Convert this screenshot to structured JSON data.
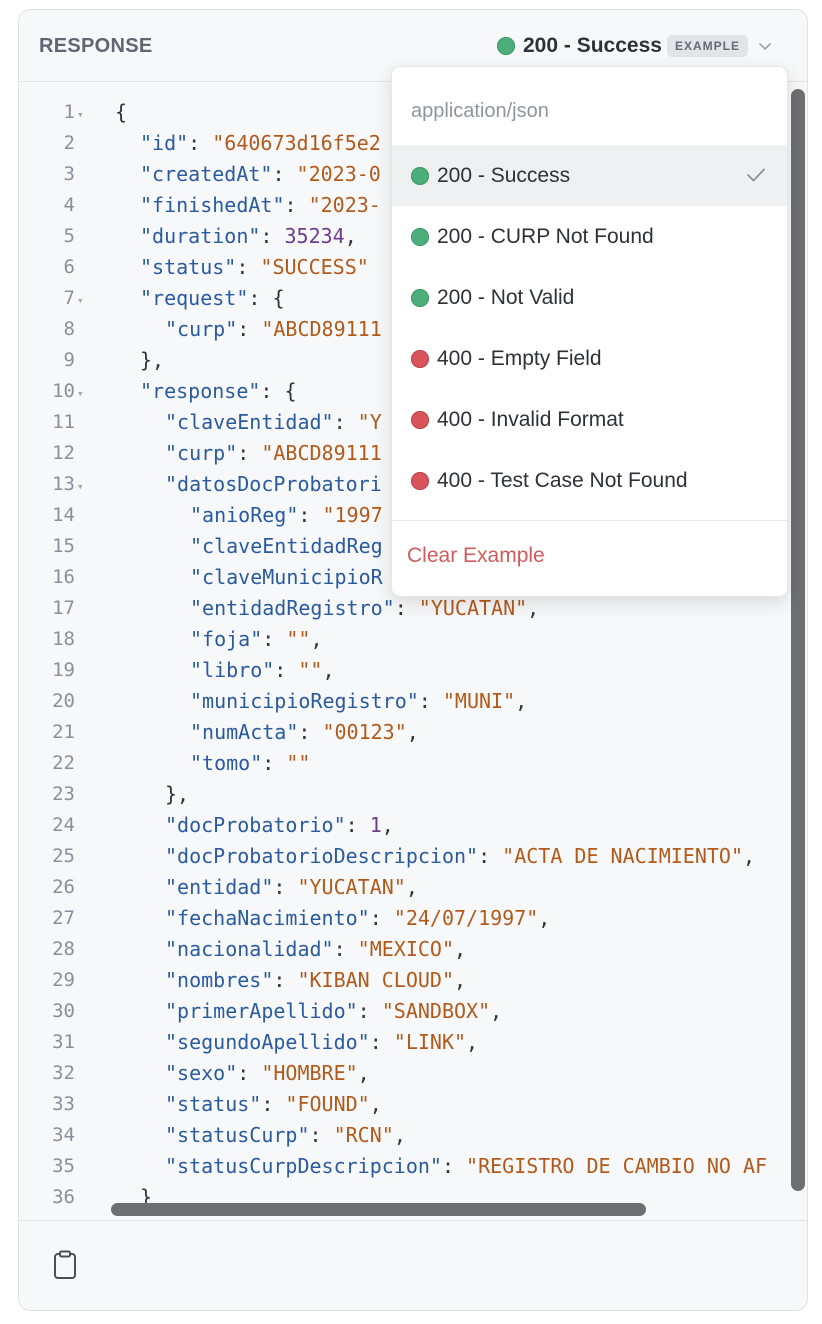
{
  "header": {
    "title": "RESPONSE",
    "selected_status": "200 - Success",
    "badge": "EXAMPLE",
    "status_color": "#4caf7a"
  },
  "code": {
    "lines": [
      {
        "n": "1",
        "fold": true,
        "indent": 0,
        "parts": [
          [
            "p",
            "{"
          ]
        ]
      },
      {
        "n": "2",
        "indent": 1,
        "parts": [
          [
            "k",
            "\"id\""
          ],
          [
            "p",
            ": "
          ],
          [
            "s",
            "\"640673d16f5e2"
          ]
        ]
      },
      {
        "n": "3",
        "indent": 1,
        "parts": [
          [
            "k",
            "\"createdAt\""
          ],
          [
            "p",
            ": "
          ],
          [
            "s",
            "\"2023-0"
          ]
        ]
      },
      {
        "n": "4",
        "indent": 1,
        "parts": [
          [
            "k",
            "\"finishedAt\""
          ],
          [
            "p",
            ": "
          ],
          [
            "s",
            "\"2023-"
          ]
        ]
      },
      {
        "n": "5",
        "indent": 1,
        "parts": [
          [
            "k",
            "\"duration\""
          ],
          [
            "p",
            ": "
          ],
          [
            "n",
            "35234"
          ],
          [
            "p",
            ","
          ]
        ]
      },
      {
        "n": "6",
        "indent": 1,
        "parts": [
          [
            "k",
            "\"status\""
          ],
          [
            "p",
            ": "
          ],
          [
            "s",
            "\"SUCCESS\""
          ]
        ]
      },
      {
        "n": "7",
        "fold": true,
        "indent": 1,
        "parts": [
          [
            "k",
            "\"request\""
          ],
          [
            "p",
            ": {"
          ]
        ]
      },
      {
        "n": "8",
        "indent": 2,
        "parts": [
          [
            "k",
            "\"curp\""
          ],
          [
            "p",
            ": "
          ],
          [
            "s",
            "\"ABCD89111"
          ]
        ]
      },
      {
        "n": "9",
        "indent": 1,
        "parts": [
          [
            "p",
            "},"
          ]
        ]
      },
      {
        "n": "10",
        "fold": true,
        "indent": 1,
        "parts": [
          [
            "k",
            "\"response\""
          ],
          [
            "p",
            ": {"
          ]
        ]
      },
      {
        "n": "11",
        "indent": 2,
        "parts": [
          [
            "k",
            "\"claveEntidad\""
          ],
          [
            "p",
            ": "
          ],
          [
            "s",
            "\"Y"
          ]
        ]
      },
      {
        "n": "12",
        "indent": 2,
        "parts": [
          [
            "k",
            "\"curp\""
          ],
          [
            "p",
            ": "
          ],
          [
            "s",
            "\"ABCD89111"
          ]
        ]
      },
      {
        "n": "13",
        "fold": true,
        "indent": 2,
        "parts": [
          [
            "k",
            "\"datosDocProbatori"
          ]
        ]
      },
      {
        "n": "14",
        "indent": 3,
        "parts": [
          [
            "k",
            "\"anioReg\""
          ],
          [
            "p",
            ": "
          ],
          [
            "s",
            "\"1997"
          ]
        ]
      },
      {
        "n": "15",
        "indent": 3,
        "parts": [
          [
            "k",
            "\"claveEntidadReg"
          ]
        ]
      },
      {
        "n": "16",
        "indent": 3,
        "parts": [
          [
            "k",
            "\"claveMunicipioR"
          ]
        ]
      },
      {
        "n": "17",
        "indent": 3,
        "parts": [
          [
            "k",
            "\"entidadRegistro\""
          ],
          [
            "p",
            ": "
          ],
          [
            "s",
            "\"YUCATAN\""
          ],
          [
            "p",
            ","
          ]
        ]
      },
      {
        "n": "18",
        "indent": 3,
        "parts": [
          [
            "k",
            "\"foja\""
          ],
          [
            "p",
            ": "
          ],
          [
            "s",
            "\"\""
          ],
          [
            "p",
            ","
          ]
        ]
      },
      {
        "n": "19",
        "indent": 3,
        "parts": [
          [
            "k",
            "\"libro\""
          ],
          [
            "p",
            ": "
          ],
          [
            "s",
            "\"\""
          ],
          [
            "p",
            ","
          ]
        ]
      },
      {
        "n": "20",
        "indent": 3,
        "parts": [
          [
            "k",
            "\"municipioRegistro\""
          ],
          [
            "p",
            ": "
          ],
          [
            "s",
            "\"MUNI\""
          ],
          [
            "p",
            ","
          ]
        ]
      },
      {
        "n": "21",
        "indent": 3,
        "parts": [
          [
            "k",
            "\"numActa\""
          ],
          [
            "p",
            ": "
          ],
          [
            "s",
            "\"00123\""
          ],
          [
            "p",
            ","
          ]
        ]
      },
      {
        "n": "22",
        "indent": 3,
        "parts": [
          [
            "k",
            "\"tomo\""
          ],
          [
            "p",
            ": "
          ],
          [
            "s",
            "\"\""
          ]
        ]
      },
      {
        "n": "23",
        "indent": 2,
        "parts": [
          [
            "p",
            "},"
          ]
        ]
      },
      {
        "n": "24",
        "indent": 2,
        "parts": [
          [
            "k",
            "\"docProbatorio\""
          ],
          [
            "p",
            ": "
          ],
          [
            "n",
            "1"
          ],
          [
            "p",
            ","
          ]
        ]
      },
      {
        "n": "25",
        "indent": 2,
        "parts": [
          [
            "k",
            "\"docProbatorioDescripcion\""
          ],
          [
            "p",
            ": "
          ],
          [
            "s",
            "\"ACTA DE NACIMIENTO\""
          ],
          [
            "p",
            ","
          ]
        ]
      },
      {
        "n": "26",
        "indent": 2,
        "parts": [
          [
            "k",
            "\"entidad\""
          ],
          [
            "p",
            ": "
          ],
          [
            "s",
            "\"YUCATAN\""
          ],
          [
            "p",
            ","
          ]
        ]
      },
      {
        "n": "27",
        "indent": 2,
        "parts": [
          [
            "k",
            "\"fechaNacimiento\""
          ],
          [
            "p",
            ": "
          ],
          [
            "s",
            "\"24/07/1997\""
          ],
          [
            "p",
            ","
          ]
        ]
      },
      {
        "n": "28",
        "indent": 2,
        "parts": [
          [
            "k",
            "\"nacionalidad\""
          ],
          [
            "p",
            ": "
          ],
          [
            "s",
            "\"MEXICO\""
          ],
          [
            "p",
            ","
          ]
        ]
      },
      {
        "n": "29",
        "indent": 2,
        "parts": [
          [
            "k",
            "\"nombres\""
          ],
          [
            "p",
            ": "
          ],
          [
            "s",
            "\"KIBAN CLOUD\""
          ],
          [
            "p",
            ","
          ]
        ]
      },
      {
        "n": "30",
        "indent": 2,
        "parts": [
          [
            "k",
            "\"primerApellido\""
          ],
          [
            "p",
            ": "
          ],
          [
            "s",
            "\"SANDBOX\""
          ],
          [
            "p",
            ","
          ]
        ]
      },
      {
        "n": "31",
        "indent": 2,
        "parts": [
          [
            "k",
            "\"segundoApellido\""
          ],
          [
            "p",
            ": "
          ],
          [
            "s",
            "\"LINK\""
          ],
          [
            "p",
            ","
          ]
        ]
      },
      {
        "n": "32",
        "indent": 2,
        "parts": [
          [
            "k",
            "\"sexo\""
          ],
          [
            "p",
            ": "
          ],
          [
            "s",
            "\"HOMBRE\""
          ],
          [
            "p",
            ","
          ]
        ]
      },
      {
        "n": "33",
        "indent": 2,
        "parts": [
          [
            "k",
            "\"status\""
          ],
          [
            "p",
            ": "
          ],
          [
            "s",
            "\"FOUND\""
          ],
          [
            "p",
            ","
          ]
        ]
      },
      {
        "n": "34",
        "indent": 2,
        "parts": [
          [
            "k",
            "\"statusCurp\""
          ],
          [
            "p",
            ": "
          ],
          [
            "s",
            "\"RCN\""
          ],
          [
            "p",
            ","
          ]
        ]
      },
      {
        "n": "35",
        "indent": 2,
        "parts": [
          [
            "k",
            "\"statusCurpDescripcion\""
          ],
          [
            "p",
            ": "
          ],
          [
            "s",
            "\"REGISTRO DE CAMBIO NO AF"
          ]
        ]
      },
      {
        "n": "36",
        "indent": 1,
        "parts": [
          [
            "p",
            "}"
          ]
        ]
      }
    ]
  },
  "dropdown": {
    "content_type": "application/json",
    "items": [
      {
        "label": "200 - Success",
        "status": "green",
        "selected": true
      },
      {
        "label": "200 - CURP Not Found",
        "status": "green"
      },
      {
        "label": "200 - Not Valid",
        "status": "green"
      },
      {
        "label": "400 - Empty Field",
        "status": "red"
      },
      {
        "label": "400 - Invalid Format",
        "status": "red"
      },
      {
        "label": "400 - Test Case Not Found",
        "status": "red"
      }
    ],
    "clear_label": "Clear Example"
  },
  "footer": {
    "copy_icon": "clipboard-icon"
  },
  "colors": {
    "success": "#4caf7a",
    "error": "#d9545b",
    "key": "#2a5aa0",
    "string": "#b35a1b",
    "number": "#6d3c8a",
    "clear": "#cf5b5f"
  }
}
